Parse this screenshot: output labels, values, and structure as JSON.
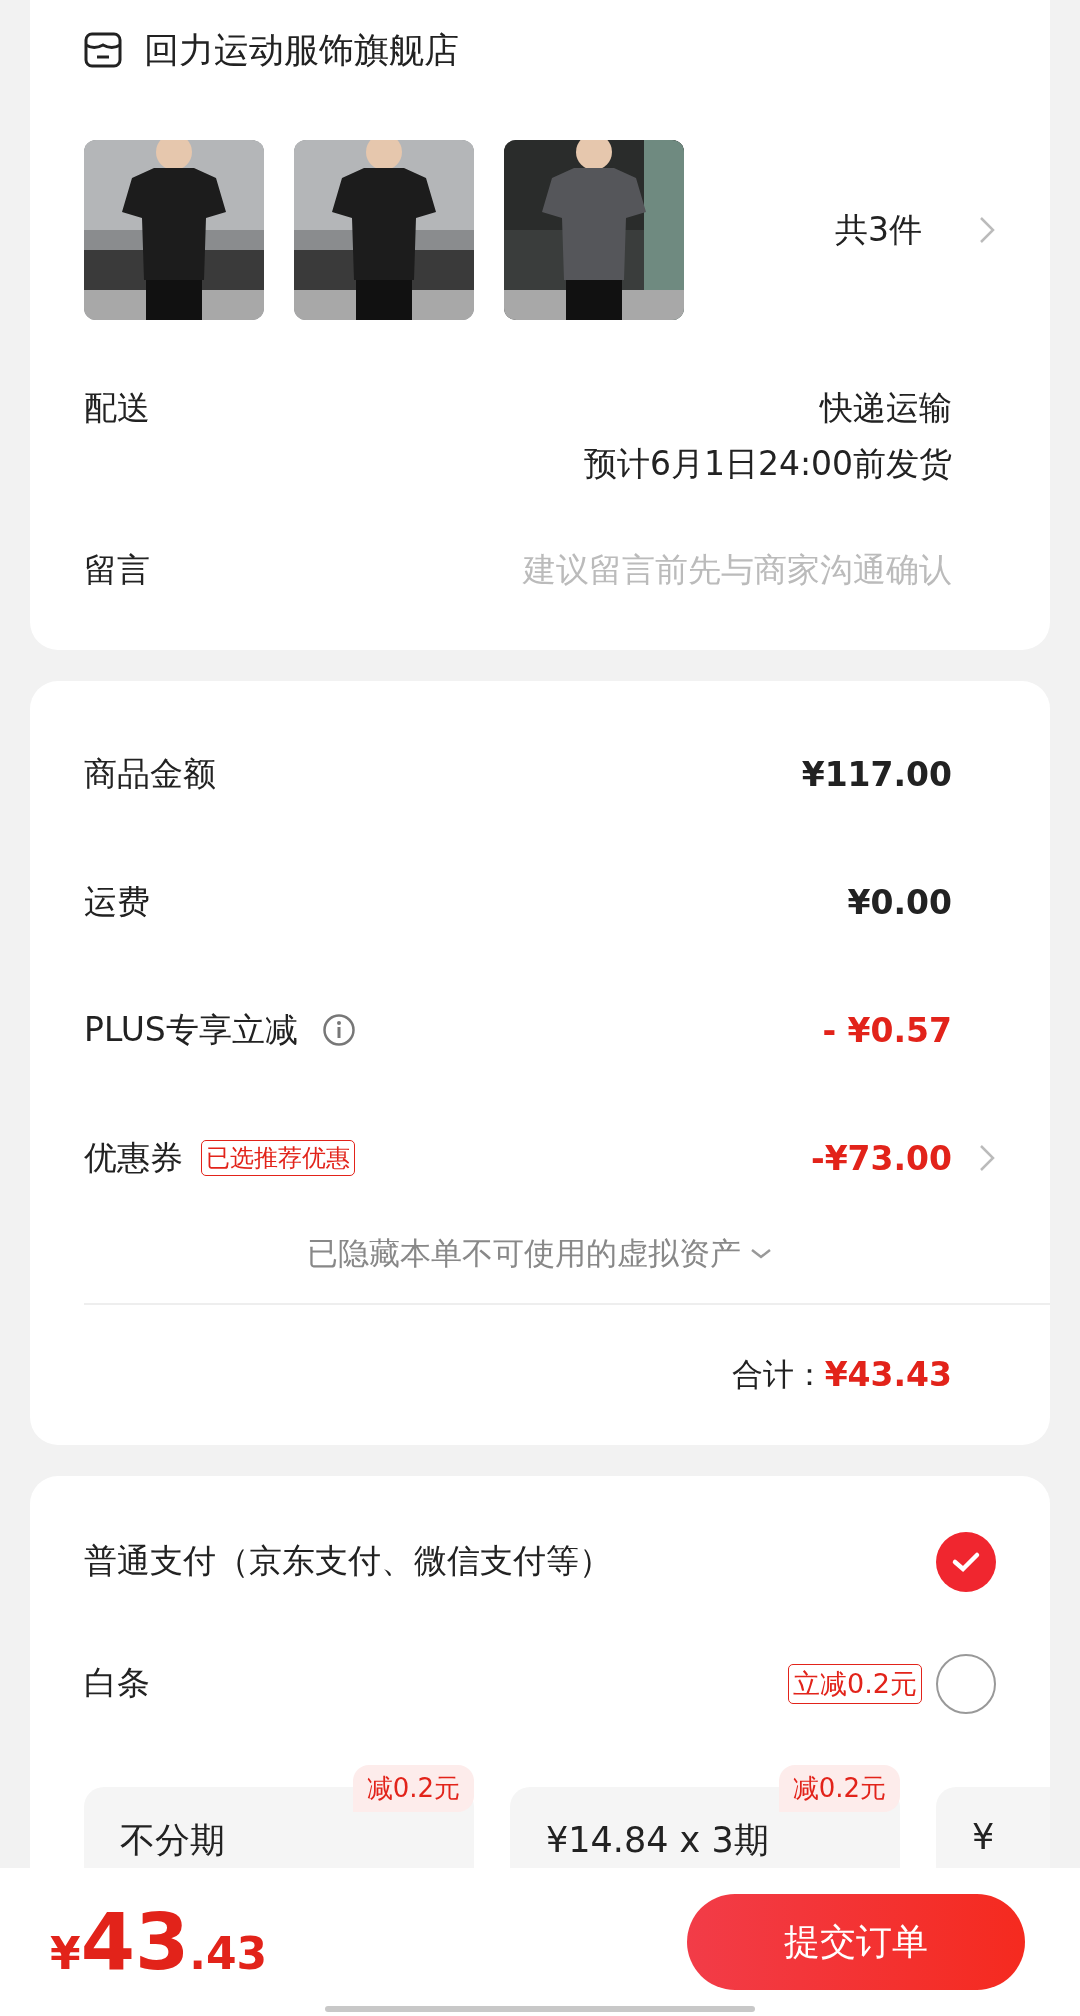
{
  "store": {
    "name": "回力运动服饰旗舰店"
  },
  "count": "共3件",
  "delivery": {
    "label": "配送",
    "method": "快递运输",
    "estimate": "预计6月1日24:00前发货"
  },
  "message": {
    "label": "留言",
    "placeholder": "建议留言前先与商家沟通确认"
  },
  "summary": {
    "rows": [
      {
        "kind": "plain",
        "label": "商品金额",
        "value": "¥117.00",
        "discount": false
      },
      {
        "kind": "plain",
        "label": "运费",
        "value": "¥0.00",
        "discount": false
      },
      {
        "kind": "info",
        "label": "PLUS专享立减",
        "value": "- ¥0.57",
        "discount": true
      },
      {
        "kind": "link",
        "label": "优惠券",
        "tag": "已选推荐优惠",
        "value": "-¥73.00",
        "discount": true
      }
    ],
    "hidden_assets": "已隐藏本单不可使用的虚拟资产",
    "total_label": "合计：",
    "total": "¥43.43"
  },
  "payment": {
    "methods": [
      {
        "label": "普通支付（京东支付、微信支付等）",
        "selected": true
      },
      {
        "label": "白条",
        "tag": "立减0.2元",
        "selected": false
      }
    ],
    "installments": [
      {
        "label": "不分期",
        "badge": "减0.2元"
      },
      {
        "label": "¥14.84 x 3期",
        "badge": "减0.2元"
      },
      {
        "label": "¥"
      }
    ]
  },
  "footer": {
    "symbol": "¥",
    "integer": "43",
    "decimal": ".43",
    "submit": "提交订单"
  }
}
